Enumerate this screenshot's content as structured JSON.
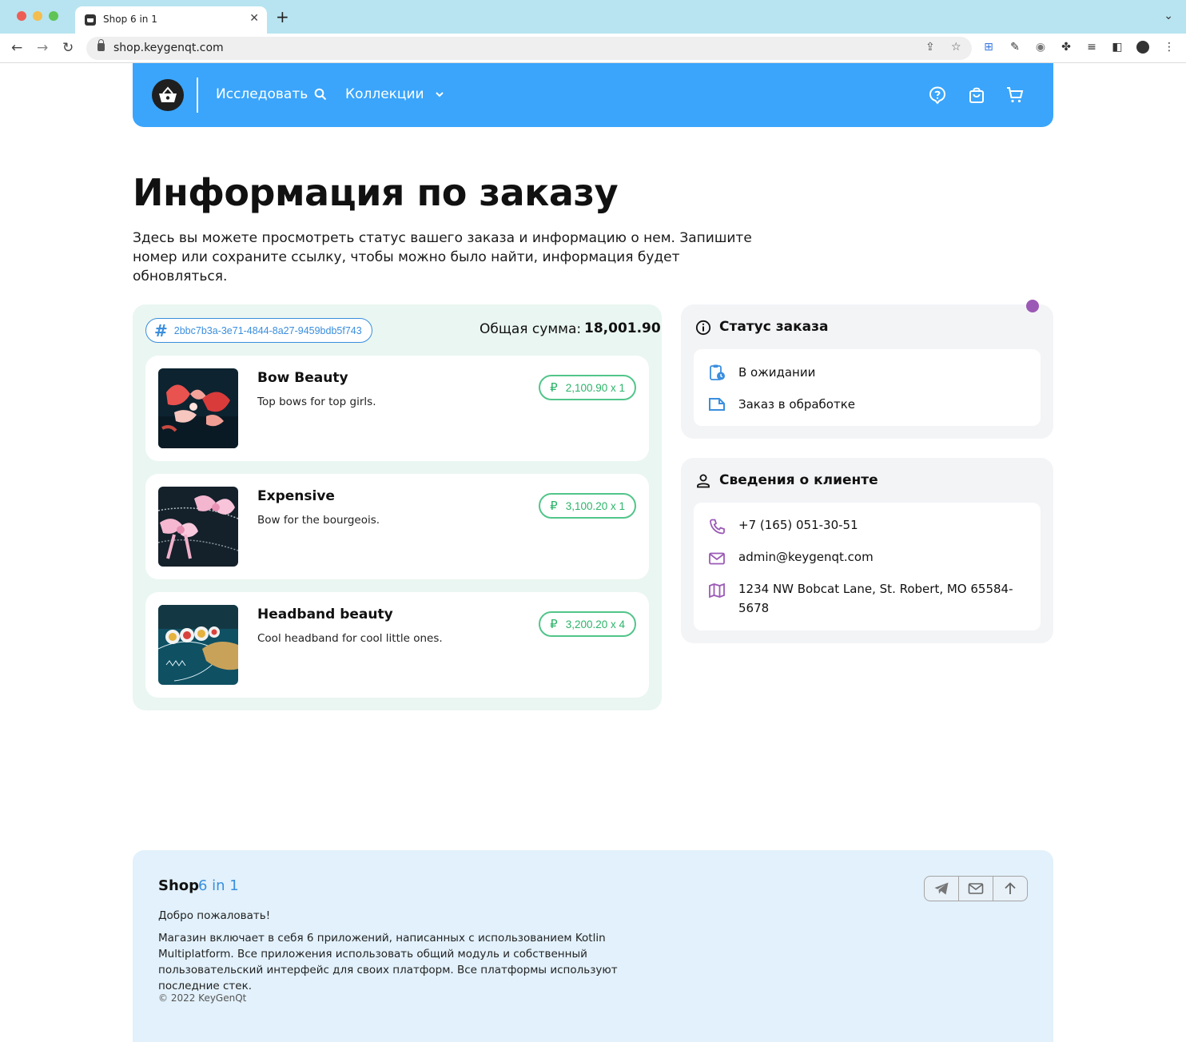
{
  "browser": {
    "tab_title": "Shop 6 in 1",
    "tab_close": "✕",
    "new_tab": "+",
    "url": "shop.keygenqt.com"
  },
  "header": {
    "nav_explore": "Исследовать",
    "nav_collections": "Коллекции",
    "accent_color": "#3aa5fb"
  },
  "page": {
    "title": "Информация по заказу",
    "description": "Здесь вы можете просмотреть статус вашего заказа и информацию о нем. Запишите номер или сохраните ссылку, чтобы можно было найти, информация будет обновляться."
  },
  "order": {
    "id_prefix": "#",
    "id": "2bbc7b3a-3e71-4844-8a27-9459bdb5f743",
    "total_label": "Общая сумма:",
    "total_value": "18,001.90",
    "currency_symbol": "₽",
    "items": [
      {
        "name": "Bow Beauty",
        "description": "Top bows for top girls.",
        "price": "2,100.90 x 1"
      },
      {
        "name": "Expensive",
        "description": "Bow for the bourgeois.",
        "price": "3,100.20 x 1"
      },
      {
        "name": "Headband beauty",
        "description": "Cool headband for cool little ones.",
        "price": "3,200.20 x 4"
      }
    ]
  },
  "status": {
    "title": "Статус заказа",
    "rows": [
      {
        "label": "В ожидании",
        "icon": "clipboard-clock-icon"
      },
      {
        "label": "Заказ в обработке",
        "icon": "note-icon"
      }
    ]
  },
  "customer": {
    "title": "Сведения о клиенте",
    "phone": "+7 (165) 051-30-51",
    "email": "admin@keygenqt.com",
    "address": "1234 NW Bobcat Lane, St. Robert, MO 65584-5678"
  },
  "footer": {
    "brand": "Shop",
    "brand_accent": "6 in 1",
    "welcome": "Добро пожаловать!",
    "description": "Магазин включает в себя 6 приложений, написанных с использованием Kotlin Multiplatform. Все приложения использовать общий модуль и собственный пользовательский интерфейс для своих платформ. Все платформы используют последние стек.",
    "copyright": "© 2022 KeyGenQt"
  }
}
